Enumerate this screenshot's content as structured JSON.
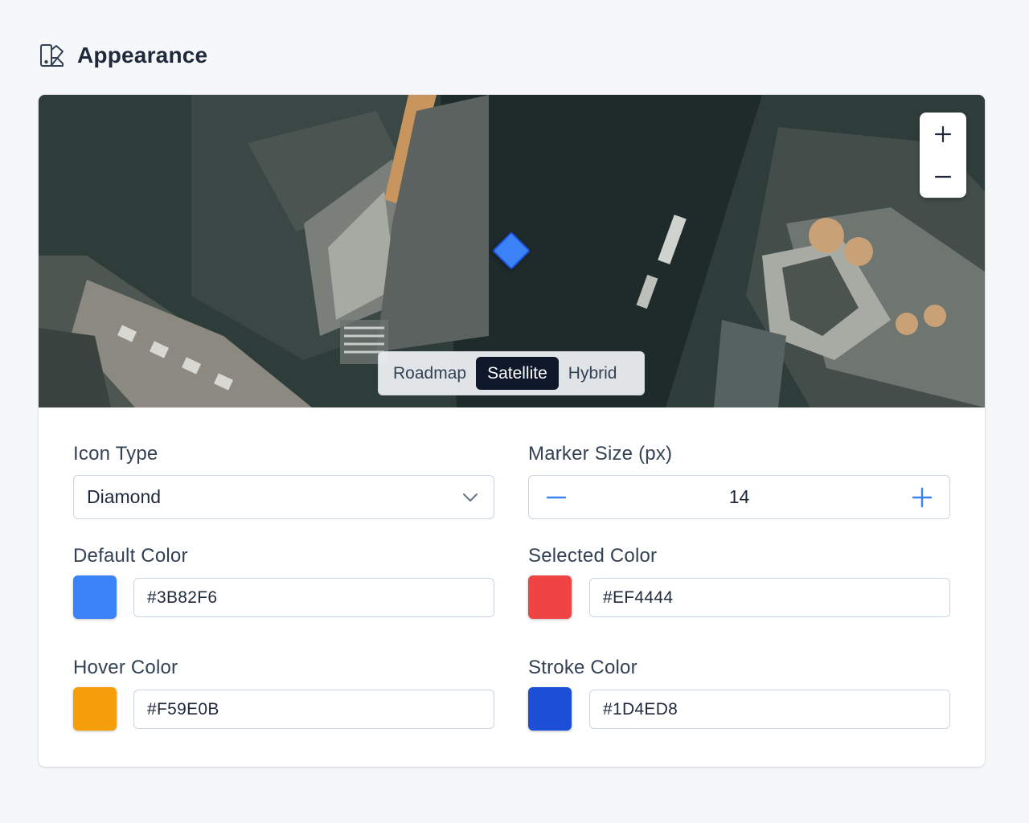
{
  "header": {
    "title": "Appearance",
    "icon": "appearance-icon"
  },
  "map": {
    "imagery": "aerial satellite view of city buildings",
    "marker_icon": "diamond",
    "marker_color": "#3B82F6",
    "marker_stroke": "#1D4ED8",
    "zoom_in_label": "+",
    "zoom_out_label": "−",
    "map_types": [
      {
        "label": "Roadmap",
        "active": false
      },
      {
        "label": "Satellite",
        "active": true
      },
      {
        "label": "Hybrid",
        "active": false
      }
    ]
  },
  "form": {
    "icon_type": {
      "label": "Icon Type",
      "value": "Diamond"
    },
    "marker_size": {
      "label": "Marker Size (px)",
      "value": "14"
    },
    "default_color": {
      "label": "Default Color",
      "value": "#3B82F6",
      "swatch": "#3B82F6"
    },
    "selected_color": {
      "label": "Selected Color",
      "value": "#EF4444",
      "swatch": "#EF4444"
    },
    "hover_color": {
      "label": "Hover Color",
      "value": "#F59E0B",
      "swatch": "#F59E0B"
    },
    "stroke_color": {
      "label": "Stroke Color",
      "value": "#1D4ED8",
      "swatch": "#1D4ED8"
    }
  },
  "theme": {
    "accent": "#3B82F6",
    "active_toggle_bg": "#0F172A",
    "background": "#F6F7F9"
  }
}
